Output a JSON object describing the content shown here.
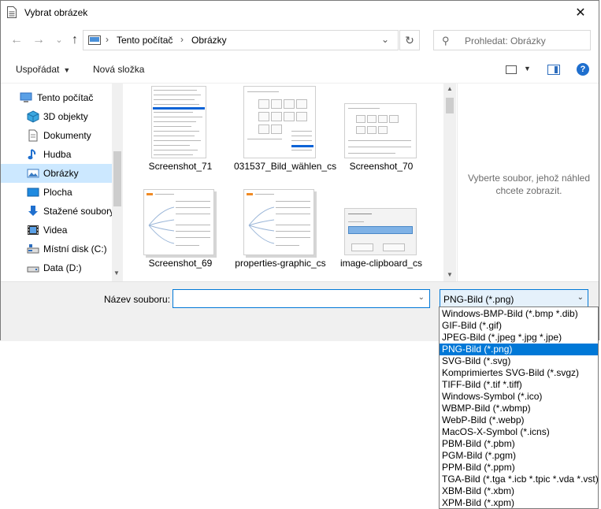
{
  "window": {
    "title": "Vybrat obrázek"
  },
  "nav": {
    "breadcrumb": [
      "Tento počítač",
      "Obrázky"
    ],
    "search_placeholder": "Prohledat: Obrázky"
  },
  "toolbar": {
    "organize": "Uspořádat",
    "new_folder": "Nová složka"
  },
  "sidebar": {
    "items": [
      {
        "label": "Tento počítač",
        "icon": "computer-icon"
      },
      {
        "label": "3D objekty",
        "icon": "3d-objects-icon"
      },
      {
        "label": "Dokumenty",
        "icon": "documents-icon"
      },
      {
        "label": "Hudba",
        "icon": "music-icon"
      },
      {
        "label": "Obrázky",
        "icon": "pictures-icon",
        "selected": true
      },
      {
        "label": "Plocha",
        "icon": "desktop-icon"
      },
      {
        "label": "Stažené soubory",
        "icon": "downloads-icon"
      },
      {
        "label": "Videa",
        "icon": "videos-icon"
      },
      {
        "label": "Místní disk (C:)",
        "icon": "local-disk-icon"
      },
      {
        "label": "Data (D:)",
        "icon": "drive-icon"
      }
    ]
  },
  "files": [
    {
      "name": "Screenshot_71"
    },
    {
      "name": "031537_Bild_wählen_cs"
    },
    {
      "name": "Screenshot_70"
    },
    {
      "name": "Screenshot_69"
    },
    {
      "name": "properties-graphic_cs"
    },
    {
      "name": "image-clipboard_cs"
    }
  ],
  "preview": {
    "message": "Vyberte soubor, jehož náhled chcete zobrazit."
  },
  "bottom": {
    "filename_label": "Název souboru:",
    "filename_value": "",
    "filetype_selected": "PNG-Bild (*.png)"
  },
  "filetype_options": [
    "Windows-BMP-Bild (*.bmp *.dib)",
    "GIF-Bild (*.gif)",
    "JPEG-Bild (*.jpeg *.jpg *.jpe)",
    "PNG-Bild (*.png)",
    "SVG-Bild (*.svg)",
    "Komprimiertes SVG-Bild (*.svgz)",
    "TIFF-Bild (*.tif *.tiff)",
    "Windows-Symbol (*.ico)",
    "WBMP-Bild (*.wbmp)",
    "WebP-Bild (*.webp)",
    "MacOS-X-Symbol (*.icns)",
    "PBM-Bild (*.pbm)",
    "PGM-Bild (*.pgm)",
    "PPM-Bild (*.ppm)",
    "TGA-Bild (*.tga *.icb *.tpic *.vda *.vst)",
    "XBM-Bild (*.xbm)",
    "XPM-Bild (*.xpm)"
  ],
  "colors": {
    "accent": "#0078d7",
    "selection": "#cce8ff"
  }
}
